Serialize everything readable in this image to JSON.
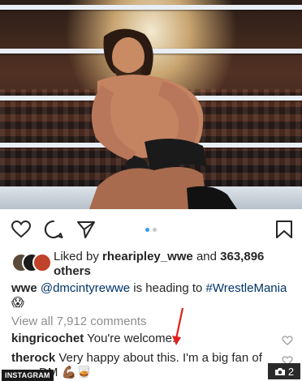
{
  "post": {
    "liked_by_prefix": "Liked by",
    "liked_by_user": "rhearipley_wwe",
    "liked_by_and": "and",
    "likes_count": "363,896",
    "likes_suffix": "others",
    "caption_user": "wwe",
    "caption_mention": "@dmcintyrewwe",
    "caption_text": "is heading to",
    "caption_hashtag": "#WrestleMania",
    "caption_emoji": "😱",
    "view_all_comments": "View all 7,912 comments",
    "comments": [
      {
        "user": "kingricochet",
        "text": "You're welcome."
      },
      {
        "user": "therock",
        "text": "Very happy about this. I'm a big fan of",
        "text2": "DM 💪🏾🥃"
      }
    ],
    "carousel": {
      "total": 2,
      "active": 1
    }
  },
  "overlay": {
    "source_tag": "INSTAGRAM",
    "photo_count": "2"
  },
  "colors": {
    "link": "#003569",
    "secondary_text": "#8e8e8e",
    "carousel_active": "#3897f0",
    "annotation_arrow": "#e0201c"
  },
  "icons": [
    "heart-icon",
    "comment-icon",
    "share-icon",
    "bookmark-icon",
    "comment-heart-icon",
    "camera-icon"
  ]
}
